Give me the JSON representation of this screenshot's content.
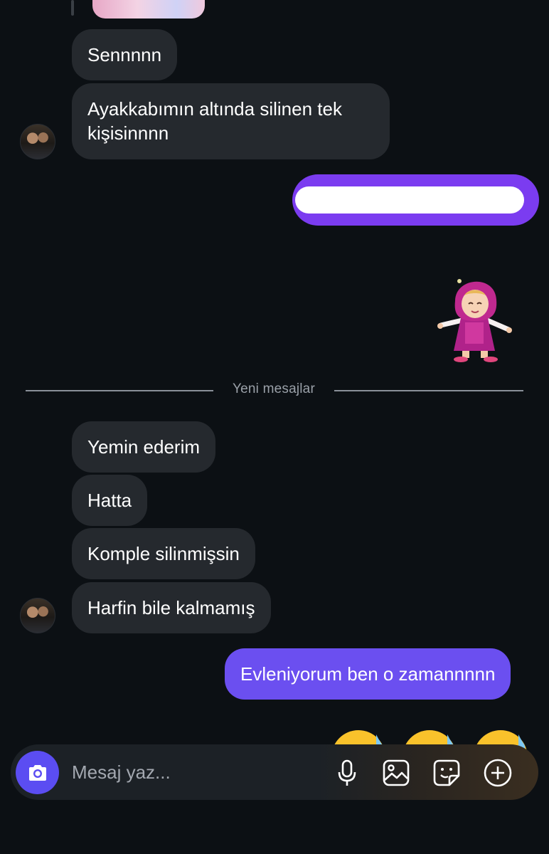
{
  "messages": {
    "received_1": "Sennnnn",
    "received_2": "Ayakkabımın altında silinen tek kişisinnnn",
    "received_3": "Yemin ederim",
    "received_4": "Hatta",
    "received_5": "Komple silinmişsin",
    "received_6": "Harfin bile kalmamış",
    "sent_1": "Evleniyorum ben o zamannnnn"
  },
  "divider": {
    "label": "Yeni mesajlar"
  },
  "composer": {
    "placeholder": "Mesaj yaz...",
    "icons": [
      "camera-icon",
      "microphone-icon",
      "gallery-icon",
      "sticker-icon",
      "add-icon"
    ]
  },
  "colors": {
    "background": "#0c1014",
    "received_bubble": "#25292e",
    "sent_bubble": "#6b4ff0",
    "camera_button": "#5b4df2"
  }
}
